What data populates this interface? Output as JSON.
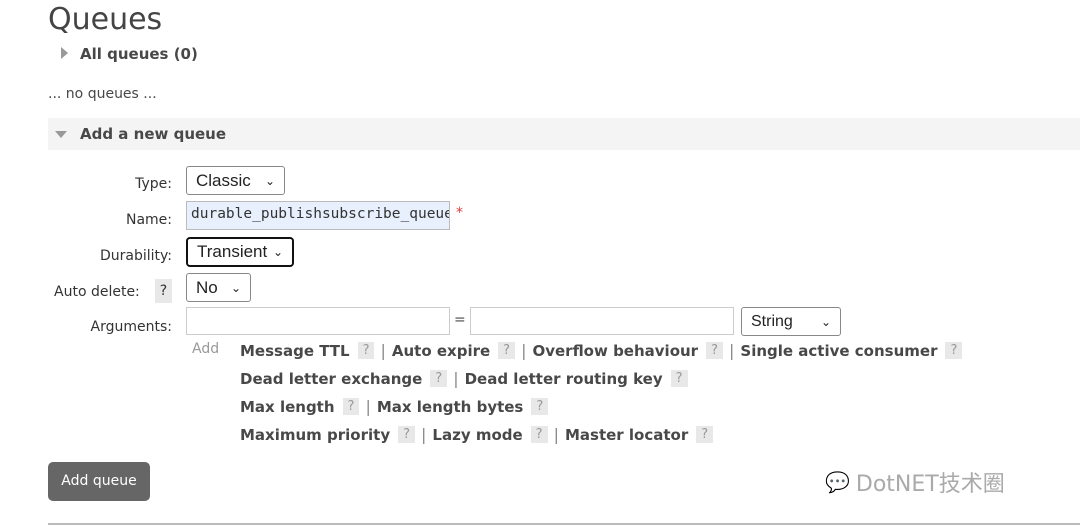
{
  "page_title": "Queues",
  "all_queues": {
    "label": "All queues (0)",
    "empty_text": "... no queues ..."
  },
  "add_section": {
    "title": "Add a new queue",
    "type": {
      "label": "Type:",
      "value": "Classic"
    },
    "name": {
      "label": "Name:",
      "value": "durable_publishsubscribe_queue",
      "required_mark": "*"
    },
    "durability": {
      "label": "Durability:",
      "value": "Transient"
    },
    "auto_delete": {
      "label": "Auto delete:",
      "help": "?",
      "value": "No"
    },
    "arguments": {
      "label": "Arguments:",
      "key": "",
      "equals": "=",
      "value": "",
      "type": "String",
      "add_label": "Add"
    },
    "argument_links": [
      [
        "Message TTL",
        "Auto expire",
        "Overflow behaviour",
        "Single active consumer"
      ],
      [
        "Dead letter exchange",
        "Dead letter routing key"
      ],
      [
        "Max length",
        "Max length bytes"
      ],
      [
        "Maximum priority",
        "Lazy mode",
        "Master locator"
      ]
    ],
    "help_mark": "?",
    "separator": "|",
    "submit_label": "Add queue"
  },
  "watermark": "DotNET技术圈",
  "colors": {
    "button_bg": "#666666",
    "section_bg": "#f4f4f4",
    "autofill_bg": "#e8f0fe",
    "required": "#e04040"
  }
}
